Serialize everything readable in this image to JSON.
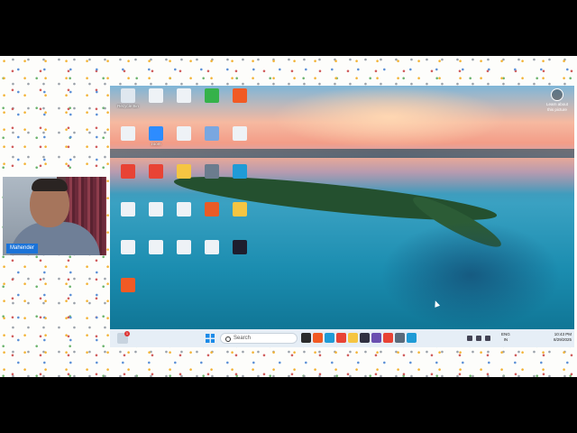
{
  "webcam": {
    "name_tag": "Mahender"
  },
  "desktop": {
    "learn_more": "Learn about this picture",
    "icons": [
      {
        "label": "Recycle Bin",
        "icon": "recycle-bin-icon",
        "color": "#dfe7ef"
      },
      {
        "label": "",
        "icon": "document-icon",
        "color": "#eef2f6"
      },
      {
        "label": "",
        "icon": "document-icon",
        "color": "#eef2f6"
      },
      {
        "label": "",
        "icon": "app-icon",
        "color": "#35b24a"
      },
      {
        "label": "",
        "icon": "brave-icon",
        "color": "#f15a24"
      },
      {
        "label": "",
        "icon": "document-icon",
        "color": "#eef2f6"
      },
      {
        "label": "zoom",
        "icon": "zoom-icon",
        "color": "#2d8cff"
      },
      {
        "label": "",
        "icon": "document-icon",
        "color": "#eef2f6"
      },
      {
        "label": "",
        "icon": "app-icon",
        "color": "#7aa7e0"
      },
      {
        "label": "",
        "icon": "document-icon",
        "color": "#eef2f6"
      },
      {
        "label": "",
        "icon": "chrome-icon",
        "color": "#e84335"
      },
      {
        "label": "",
        "icon": "chrome-icon",
        "color": "#e84335"
      },
      {
        "label": "",
        "icon": "folder-icon",
        "color": "#f5c542"
      },
      {
        "label": "",
        "icon": "photo-icon",
        "color": "#6b7c8e"
      },
      {
        "label": "",
        "icon": "edge-icon",
        "color": "#1f9bd6"
      },
      {
        "label": "",
        "icon": "document-icon",
        "color": "#eef2f6"
      },
      {
        "label": "",
        "icon": "document-icon",
        "color": "#eef2f6"
      },
      {
        "label": "",
        "icon": "document-icon",
        "color": "#eef2f6"
      },
      {
        "label": "",
        "icon": "app-icon",
        "color": "#ea5b25"
      },
      {
        "label": "",
        "icon": "folder-icon",
        "color": "#f5c542"
      },
      {
        "label": "",
        "icon": "document-icon",
        "color": "#eef2f6"
      },
      {
        "label": "",
        "icon": "document-icon",
        "color": "#eef2f6"
      },
      {
        "label": "",
        "icon": "document-icon",
        "color": "#eef2f6"
      },
      {
        "label": "",
        "icon": "document-icon",
        "color": "#eef2f6"
      },
      {
        "label": "",
        "icon": "terminal-icon",
        "color": "#1e1e2e"
      },
      {
        "label": "",
        "icon": "brave-icon",
        "color": "#f15a24"
      }
    ]
  },
  "taskbar": {
    "widget_badge": "1",
    "search_placeholder": "Search",
    "apps": [
      {
        "icon": "app-icon",
        "color": "#2b2b2b"
      },
      {
        "icon": "brave-icon",
        "color": "#f15a24"
      },
      {
        "icon": "edge-icon",
        "color": "#1f9bd6"
      },
      {
        "icon": "chrome-icon",
        "color": "#e84335"
      },
      {
        "icon": "file-explorer-icon",
        "color": "#f5c542"
      },
      {
        "icon": "app-icon",
        "color": "#303040"
      },
      {
        "icon": "app-icon",
        "color": "#6a4fb0"
      },
      {
        "icon": "chrome-icon",
        "color": "#e84335"
      },
      {
        "icon": "settings-icon",
        "color": "#5a6b7b"
      },
      {
        "icon": "app-icon",
        "color": "#1f9bd6"
      }
    ],
    "lang_top": "ENG",
    "lang_bottom": "IN",
    "time": "10:43 PM",
    "date": "8/29/2025"
  }
}
